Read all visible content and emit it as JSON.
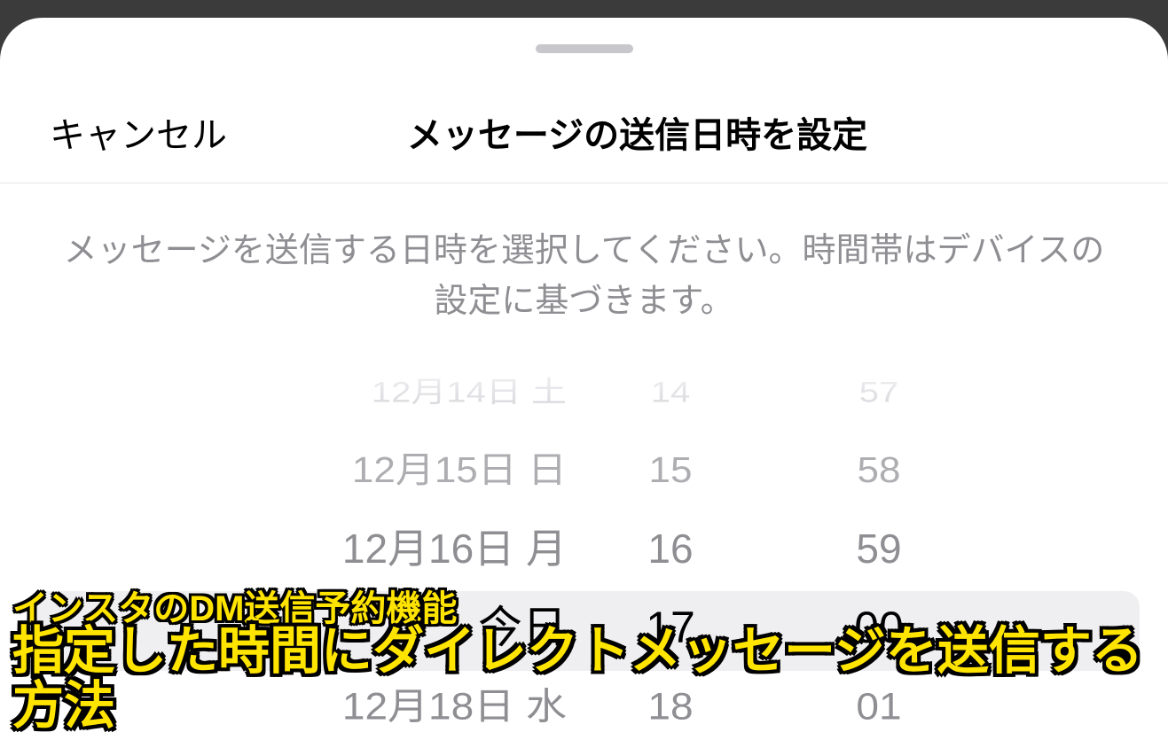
{
  "sheet": {
    "cancel_label": "キャンセル",
    "title": "メッセージの送信日時を設定",
    "instruction": "メッセージを送信する日時を選択してください。時間帯はデバイスの設定に基づきます。"
  },
  "picker": {
    "date": {
      "options": [
        "12月14日 土",
        "12月15日 日",
        "12月16日 月",
        "今日",
        "12月18日 水"
      ],
      "selected": "今日"
    },
    "hour": {
      "options": [
        "14",
        "15",
        "16",
        "17",
        "18"
      ],
      "selected": "17"
    },
    "minute": {
      "options": [
        "57",
        "58",
        "59",
        "00",
        "01"
      ],
      "selected": "00"
    }
  },
  "caption": {
    "line1": "インスタのDM送信予約機能",
    "line2": "指定した時間にダイレクトメッセージを送信する方法"
  }
}
